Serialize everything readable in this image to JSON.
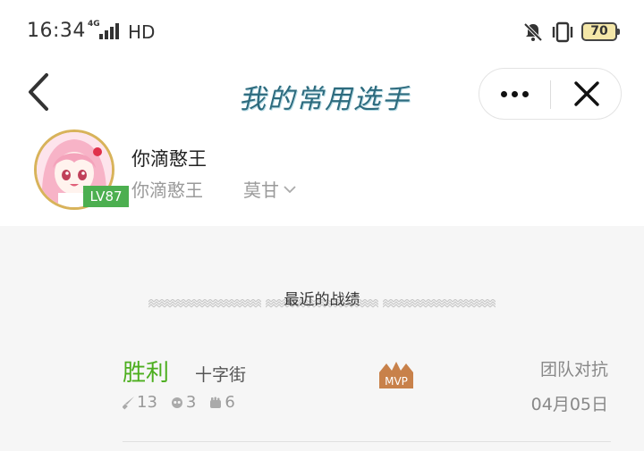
{
  "status_bar": {
    "time": "16:34",
    "network": "4G",
    "hd": "HD",
    "battery": "70"
  },
  "nav": {
    "title": "我的常用选手"
  },
  "profile": {
    "name": "你滴憨王",
    "server": "你滴憨王",
    "role": "莫甘",
    "level": "LV87"
  },
  "section": {
    "title": "最近的战绩"
  },
  "match": {
    "result": "胜利",
    "map": "十字街",
    "badge": "MVP",
    "mode": "团队对抗",
    "date": "04月05日",
    "kills": "13",
    "deaths": "3",
    "assists": "6"
  },
  "colors": {
    "win": "#4cae1e",
    "level_badge": "#4caf50",
    "mvp": "#c8814a",
    "title": "#2d6b7e"
  }
}
